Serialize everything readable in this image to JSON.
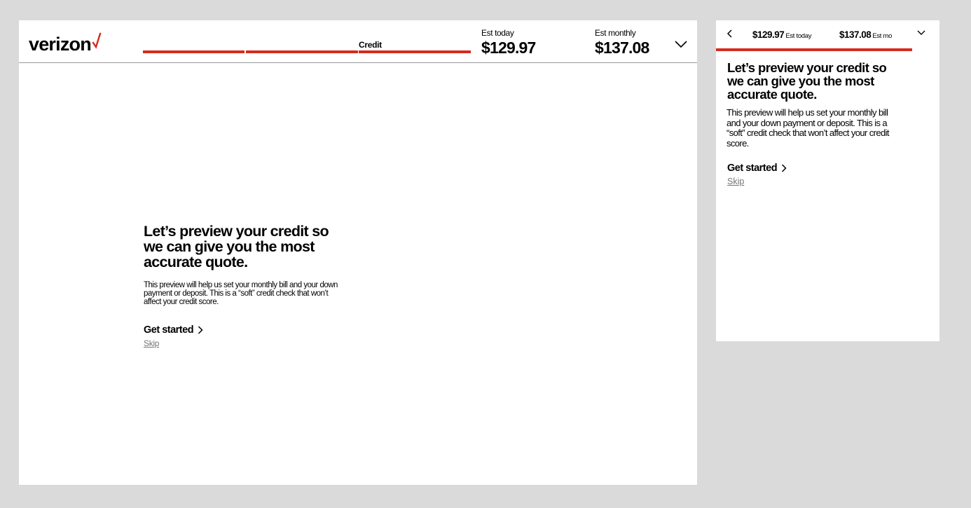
{
  "brand": {
    "name": "verizon",
    "accent_color": "#d52b1e"
  },
  "desktop": {
    "header": {
      "progress_steps": [
        {
          "label": ""
        },
        {
          "label": ""
        },
        {
          "label": "Credit"
        }
      ],
      "est_today": {
        "label": "Est today",
        "value": "$129.97"
      },
      "est_monthly": {
        "label": "Est monthly",
        "value": "$137.08"
      },
      "expand_icon": "chevron-down-icon"
    },
    "content": {
      "headline": "Let’s preview your credit so we can give you the most accurate quote.",
      "body": "This preview will help us set your monthly bill and your down payment or deposit. This is a “soft” credit check that won’t affect your credit score.",
      "cta_label": "Get started",
      "skip_label": "Skip"
    }
  },
  "mobile": {
    "header": {
      "back_icon": "chevron-left-icon",
      "est_today": {
        "value": "$129.97",
        "label": "Est today"
      },
      "est_monthly": {
        "value": "$137.08",
        "label": "Est mo"
      },
      "expand_icon": "chevron-down-icon"
    },
    "content": {
      "headline": "Let’s preview your credit so we can give you the most accurate quote.",
      "body": "This preview will help us set your monthly bill and your down payment or deposit. This is a “soft” credit check that won’t affect your credit score.",
      "cta_label": "Get started",
      "skip_label": "Skip"
    }
  }
}
